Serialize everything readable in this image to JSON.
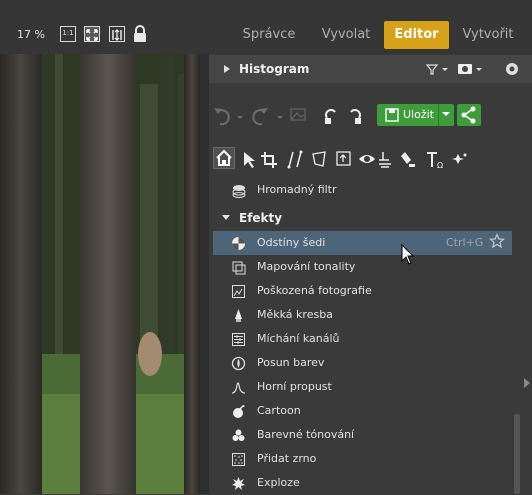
{
  "topbar": {
    "zoom": "17 %",
    "actual_size_label": "1:1",
    "tabs": [
      "Správce",
      "Vyvolat",
      "Editor",
      "Vytvořit"
    ],
    "active_tab": "Editor",
    "accent": "#d7a11a"
  },
  "histogram": {
    "title": "Histogram"
  },
  "save": {
    "label": "Uložit",
    "color": "#3e9d3a"
  },
  "list": {
    "hromadny": "Hromadný filtr",
    "section": "Efekty",
    "items": [
      {
        "label": "Odstíny šedi",
        "icon": "grayscale-icon",
        "shortcut": "Ctrl+G",
        "selected": true
      },
      {
        "label": "Mapování tonality",
        "icon": "tone-mapping-icon"
      },
      {
        "label": "Poškozená fotografie",
        "icon": "damaged-photo-icon"
      },
      {
        "label": "Měkká kresba",
        "icon": "soft-drawing-icon"
      },
      {
        "label": "Míchání kanálů",
        "icon": "channel-mixer-icon"
      },
      {
        "label": "Posun barev",
        "icon": "color-shift-icon"
      },
      {
        "label": "Horní propust",
        "icon": "high-pass-icon"
      },
      {
        "label": "Cartoon",
        "icon": "cartoon-icon"
      },
      {
        "label": "Barevné tónování",
        "icon": "color-toning-icon"
      },
      {
        "label": "Přidat zrno",
        "icon": "add-grain-icon"
      },
      {
        "label": "Exploze",
        "icon": "explosion-icon"
      }
    ],
    "selected_color": "#4e6478"
  }
}
